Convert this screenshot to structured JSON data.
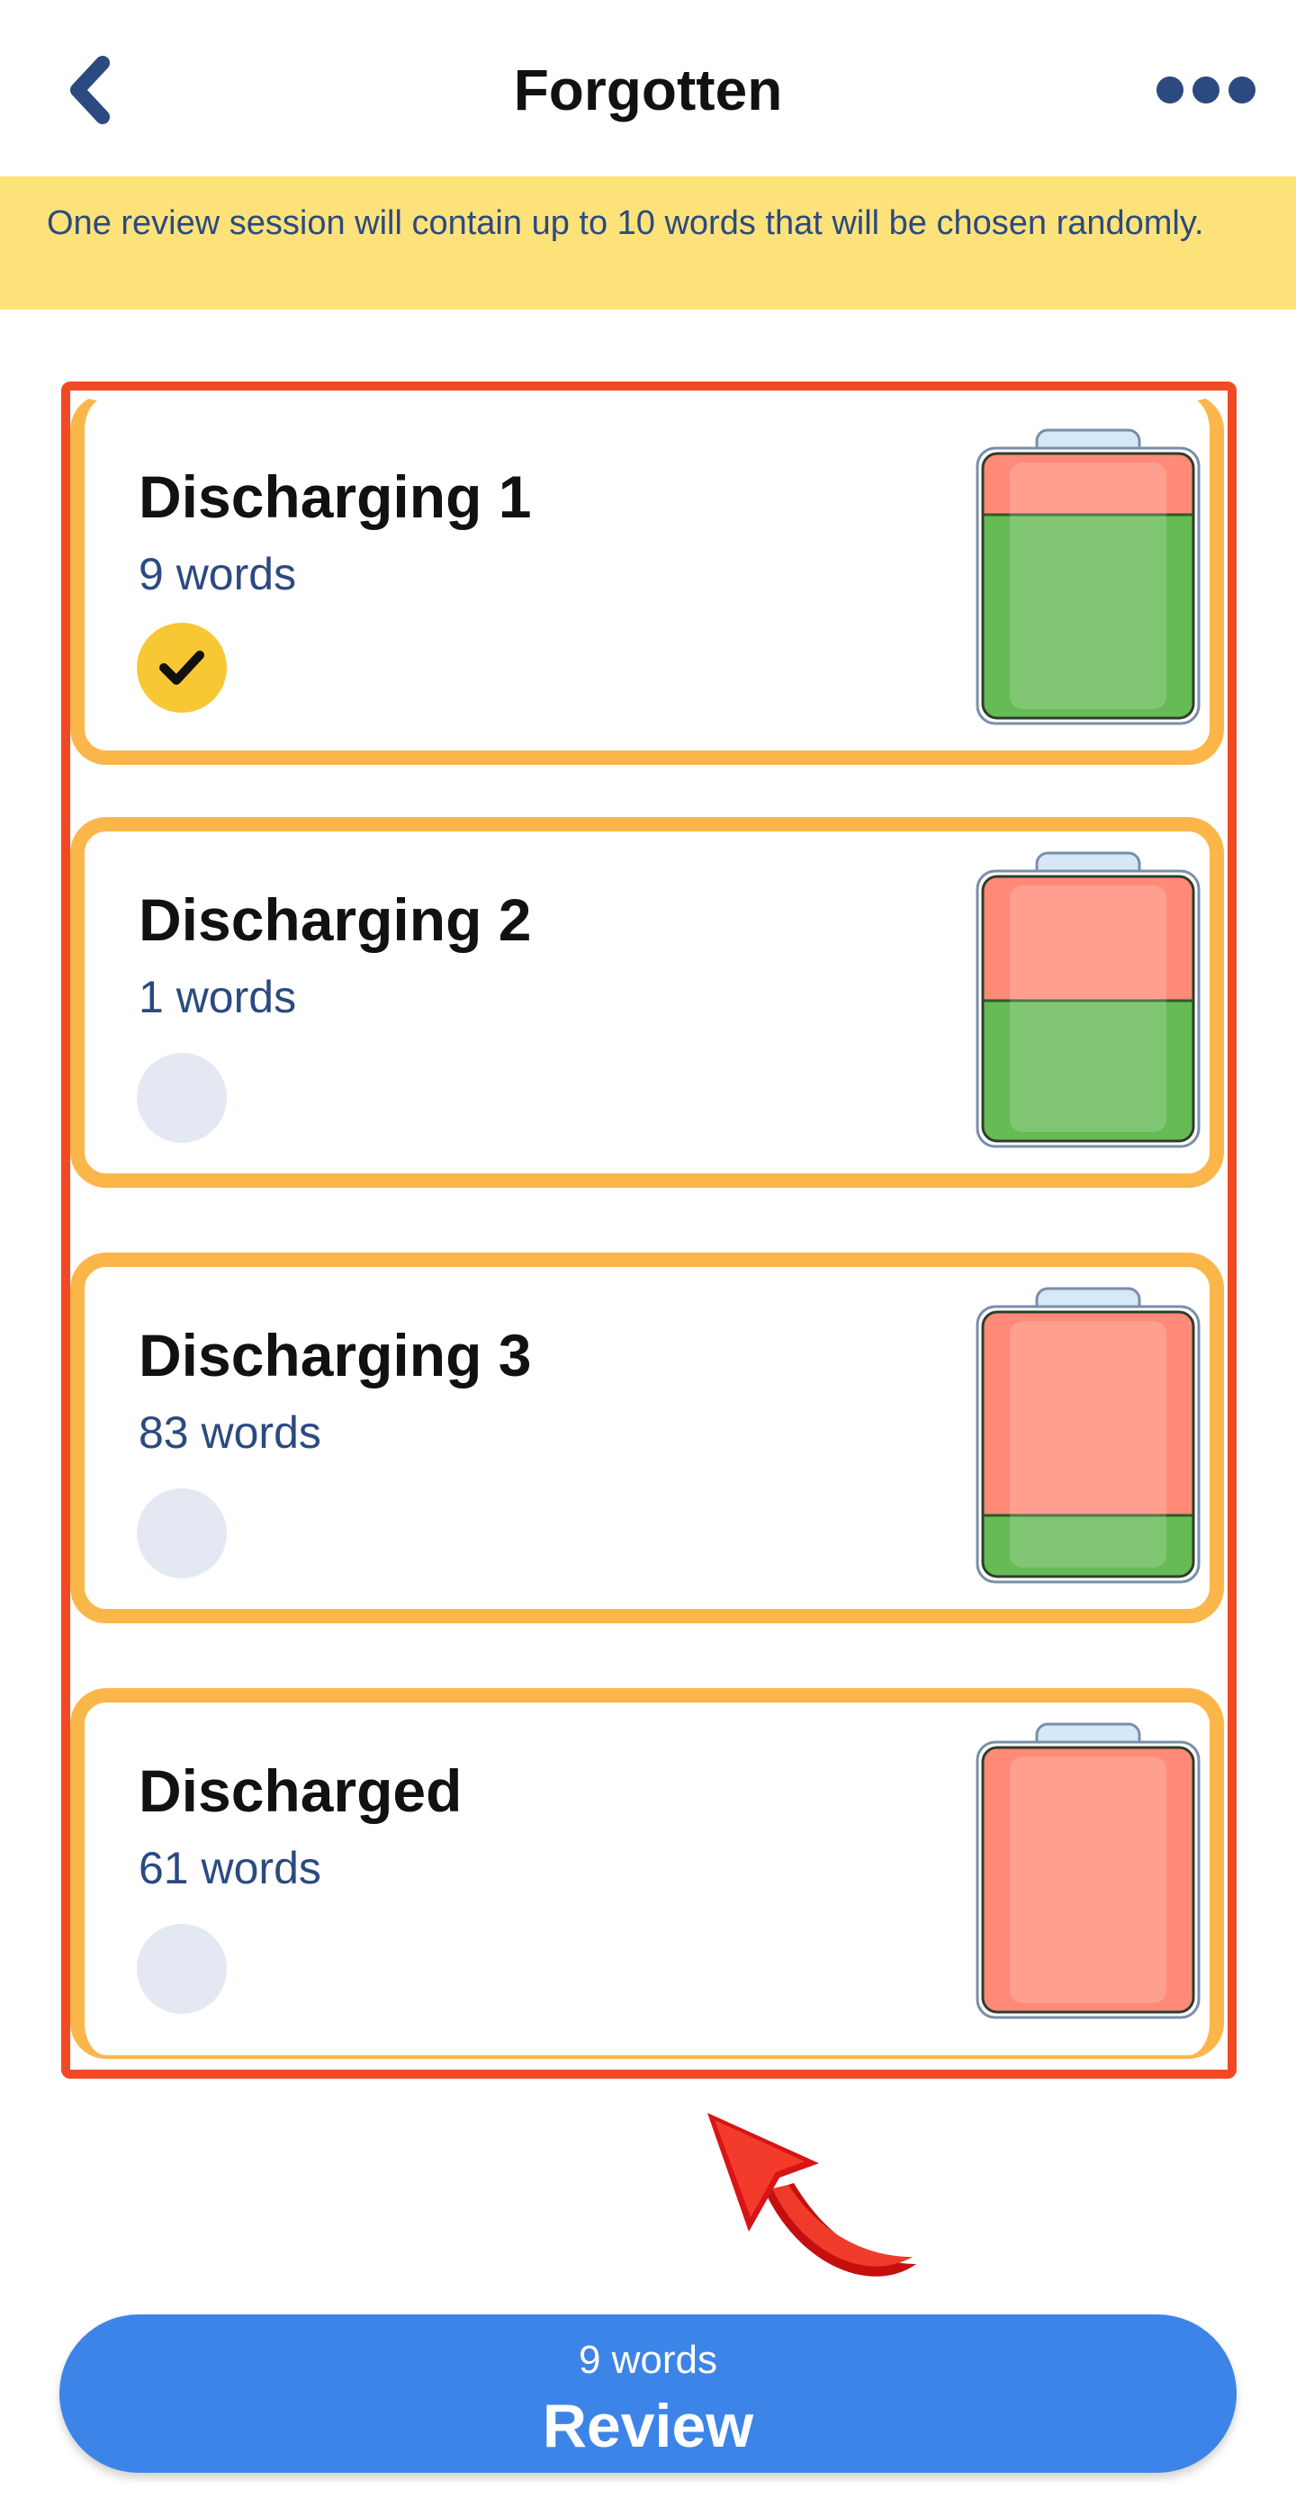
{
  "header": {
    "title": "Forgotten",
    "back_icon": "chevron-left-icon",
    "more_icon": "more-horizontal-icon"
  },
  "info_banner": {
    "text": "One review session will contain up to 10 words that will be chosen randomly."
  },
  "groups": [
    {
      "title": "Discharging 1",
      "count_label": "9 words",
      "selected": true,
      "charge_fraction": 0.77
    },
    {
      "title": "Discharging 2",
      "count_label": "1 words",
      "selected": false,
      "charge_fraction": 0.53
    },
    {
      "title": "Discharging 3",
      "count_label": "83 words",
      "selected": false,
      "charge_fraction": 0.23
    },
    {
      "title": "Discharged",
      "count_label": "61 words",
      "selected": false,
      "charge_fraction": 0.0
    }
  ],
  "review_button": {
    "count_label": "9 words",
    "label": "Review"
  },
  "colors": {
    "accent_blue": "#3d84e8",
    "banner_yellow": "#fde27a",
    "card_border_orange": "#fbb64a",
    "highlight_red": "#f04a24",
    "battery_green": "#66bb55",
    "battery_red": "#ff8a78",
    "check_yellow": "#f8c734",
    "text_navy": "#2b4a80"
  }
}
